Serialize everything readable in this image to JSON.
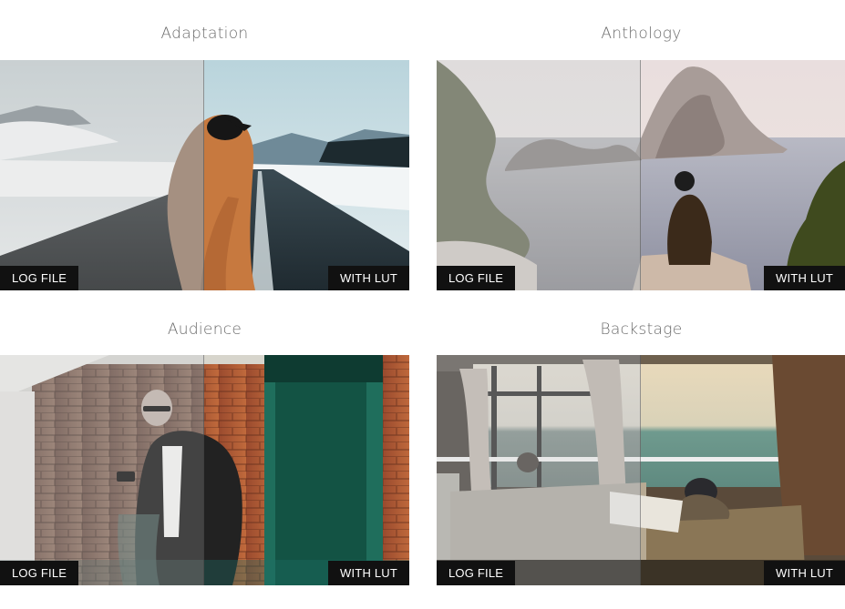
{
  "cards": [
    {
      "title": "Adaptation",
      "before_label": "LOG FILE",
      "after_label": "WITH LUT"
    },
    {
      "title": "Anthology",
      "before_label": "LOG FILE",
      "after_label": "WITH LUT"
    },
    {
      "title": "Audience",
      "before_label": "LOG FILE",
      "after_label": "WITH LUT"
    },
    {
      "title": "Backstage",
      "before_label": "LOG FILE",
      "after_label": "WITH LUT"
    }
  ],
  "colors": {
    "title_text": "#6b6b6b",
    "label_background": "#111111",
    "label_text": "#ffffff",
    "page_background": "#ffffff"
  }
}
